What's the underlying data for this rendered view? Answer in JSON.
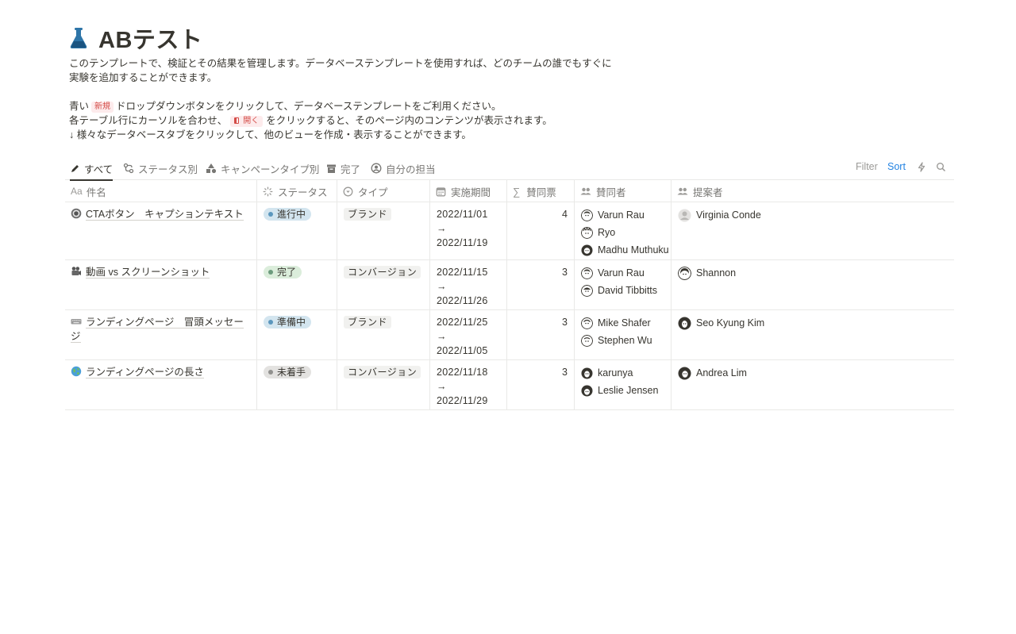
{
  "page": {
    "title": "ABテスト",
    "title_icon": "flask-icon",
    "description_lines": [
      "このテンプレートで、検証とその結果を管理します。データベーステンプレートを使用すれば、どのチームの誰でもすぐに",
      "実験を追加することができます。"
    ],
    "instruction1": {
      "before": "青い",
      "tag": "新規",
      "after": "ドロップダウンボタンをクリックして、データベーステンプレートをご利用ください。"
    },
    "instruction2": {
      "before": "各テーブル行にカーソルを合わせ、",
      "tag": "開く",
      "after": "をクリックすると、そのページ内のコンテンツが表示されます。"
    },
    "instruction3": "↓ 様々なデータベースタブをクリックして、他のビューを作成・表示することができます。"
  },
  "tabs": [
    {
      "label": "すべて",
      "icon": "pencil-icon",
      "active": true
    },
    {
      "label": "ステータス別",
      "icon": "workflow-icon",
      "active": false
    },
    {
      "label": "キャンペーンタイプ別",
      "icon": "shapes-icon",
      "active": false
    },
    {
      "label": "完了",
      "icon": "archive-icon",
      "active": false
    },
    {
      "label": "自分の担当",
      "icon": "person-circle-icon",
      "active": false
    }
  ],
  "toolbar": {
    "filter": "Filter",
    "sort": "Sort"
  },
  "columns": [
    {
      "label": "件名",
      "icon": "Aa"
    },
    {
      "label": "ステータス",
      "icon": "status-icon"
    },
    {
      "label": "タイプ",
      "icon": "select-icon"
    },
    {
      "label": "実施期間",
      "icon": "calendar-icon"
    },
    {
      "label": "賛同票",
      "icon": "sigma-icon"
    },
    {
      "label": "賛同者",
      "icon": "people-icon"
    },
    {
      "label": "提案者",
      "icon": "people-icon"
    }
  ],
  "rows": [
    {
      "name": "CTAボタン　キャプションテキスト",
      "icon": "record-button-icon",
      "status": "進行中",
      "type": "ブランド",
      "date_start": "2022/11/01",
      "date_arrow": "→",
      "date_end": "2022/11/19",
      "votes": "4",
      "supporters": [
        "Varun Rau",
        "Ryo",
        "Madhu Muthuku"
      ],
      "proposers": [
        "Virginia Conde"
      ]
    },
    {
      "name": "動画 vs スクリーンショット",
      "icon": "movie-camera-icon",
      "status": "完了",
      "type": "コンバージョン",
      "date_start": "2022/11/15",
      "date_arrow": "→",
      "date_end": "2022/11/26",
      "votes": "3",
      "supporters": [
        "Varun Rau",
        "David Tibbitts"
      ],
      "proposers": [
        "Shannon"
      ]
    },
    {
      "name": "ランディングページ　冒頭メッセージ",
      "icon": "keyboard-icon",
      "status": "準備中",
      "type": "ブランド",
      "date_start": "2022/11/25",
      "date_arrow": "→",
      "date_end": "2022/11/05",
      "votes": "3",
      "supporters": [
        "Mike Shafer",
        "Stephen Wu"
      ],
      "proposers": [
        "Seo Kyung Kim"
      ]
    },
    {
      "name": "ランディングページの長さ",
      "icon": "globe-icon",
      "status": "未着手",
      "type": "コンバージョン",
      "date_start": "2022/11/18",
      "date_arrow": "→",
      "date_end": "2022/11/29",
      "votes": "3",
      "supporters": [
        "karunya",
        "Leslie Jensen"
      ],
      "proposers": [
        "Andrea Lim"
      ]
    }
  ],
  "status_colors": {
    "進行中": {
      "bg": "#d3e5ef",
      "dot": "#5b97bd"
    },
    "完了": {
      "bg": "#dbeddb",
      "dot": "#6c9b7d"
    },
    "準備中": {
      "bg": "#d3e5ef",
      "dot": "#5b97bd"
    },
    "未着手": {
      "bg": "#e3e2e0",
      "dot": "#91918e"
    }
  },
  "colors": {
    "accent": "#2383e2",
    "text": "#37352f",
    "muted": "#787774",
    "border": "#e9e9e7",
    "flask": "#2e75a8"
  }
}
